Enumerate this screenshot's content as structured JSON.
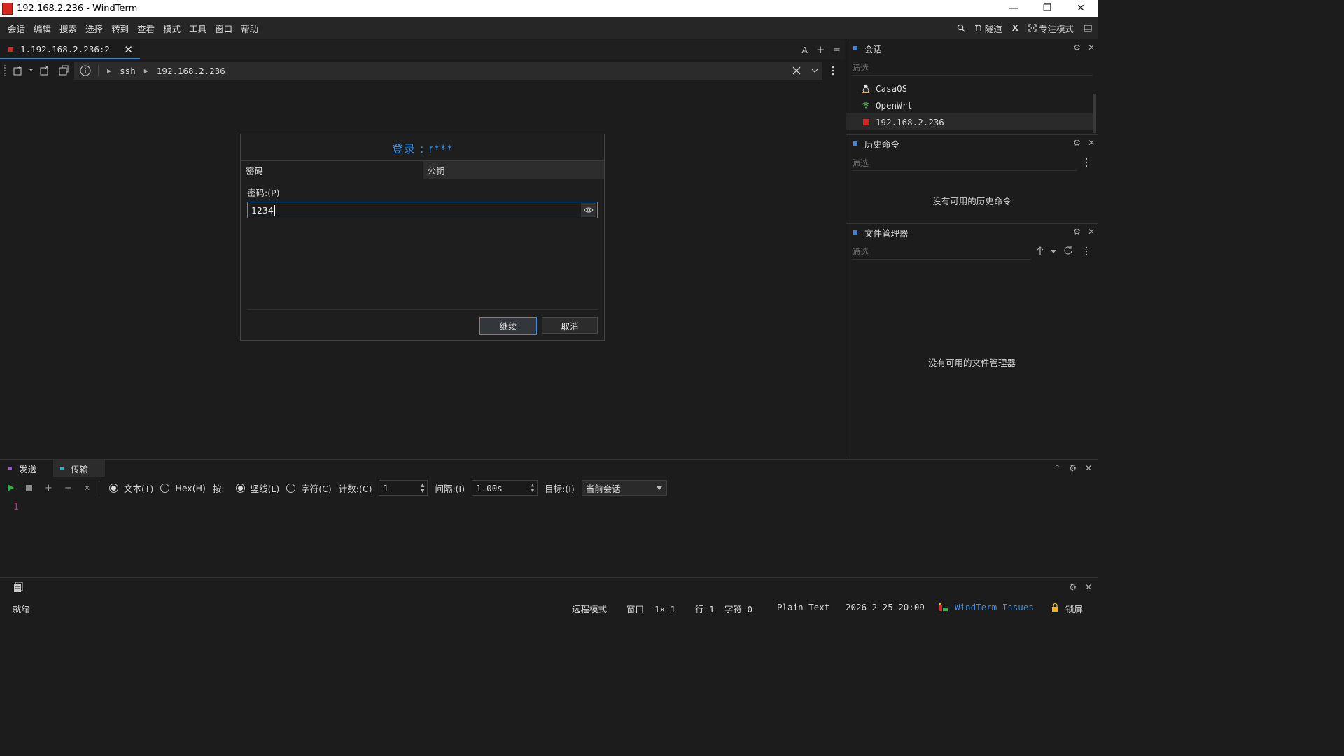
{
  "window": {
    "title": "192.168.2.236 - WindTerm",
    "minimize": "—",
    "restore": "❐",
    "close": "✕"
  },
  "menu": [
    "会话",
    "编辑",
    "搜索",
    "选择",
    "转到",
    "查看",
    "模式",
    "工具",
    "窗口",
    "帮助"
  ],
  "menu_right": {
    "tunnel": "隧道",
    "x": "X",
    "focus_mode": "专注模式"
  },
  "tabs": [
    {
      "label": "1.192.168.2.236:2",
      "color": "#d02828"
    }
  ],
  "tab_tools": {
    "font": "A",
    "add": "+",
    "menu": "≡"
  },
  "address": {
    "protocol": "ssh",
    "host": "192.168.2.236"
  },
  "dialog": {
    "title": "登录 : r***",
    "tab_password": "密码",
    "tab_pubkey": "公钥",
    "password_label": "密码:(P)",
    "password_value": "1234",
    "ok": "继续",
    "cancel": "取消"
  },
  "sessions_panel": {
    "title": "会话",
    "filter_placeholder": "筛选",
    "items": [
      {
        "label": "CasaOS",
        "icon": "linux-icon"
      },
      {
        "label": "OpenWrt",
        "icon": "wifi-icon"
      },
      {
        "label": "192.168.2.236",
        "icon": "terminal-icon"
      }
    ]
  },
  "history_panel": {
    "title": "历史命令",
    "filter_placeholder": "筛选",
    "empty": "没有可用的历史命令"
  },
  "files_panel": {
    "title": "文件管理器",
    "filter_placeholder": "筛选",
    "empty": "没有可用的文件管理器"
  },
  "send_panel": {
    "tab_send": "发送",
    "tab_transfer": "传输",
    "text_mode": "文本(T)",
    "hex_mode": "Hex(H)",
    "by_label": "按:",
    "line_mode": "竖线(L)",
    "char_mode": "字符(C)",
    "count_label": "计数:(C)",
    "count_value": "1",
    "interval_label": "间隔:(I)",
    "interval_value": "1.00s",
    "target_label": "目标:(I)",
    "target_value": "当前会话",
    "line_number": "1"
  },
  "status": {
    "ready": "就绪",
    "remote_mode": "远程模式",
    "window": "窗口 -1×-1",
    "line": "行 1",
    "char": "字符 0",
    "syntax": "Plain Text",
    "datetime": "2026-2-25 20:09",
    "issues": "WindTerm Issues",
    "lock": "锁屏"
  },
  "colors": {
    "accent": "#3c8fd9",
    "session_red": "#d02828",
    "send_purple": "#9b59d0",
    "transfer_cyan": "#1fb6c9",
    "issues_blue": "#3b8fe0"
  }
}
